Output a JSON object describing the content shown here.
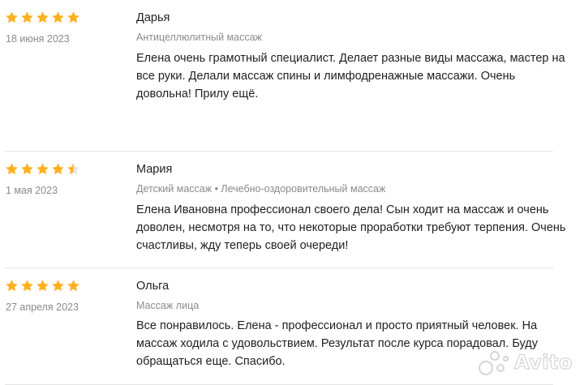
{
  "colors": {
    "star_filled": "#ffb021",
    "star_empty": "#e2e2e2",
    "muted_text": "#8a8a8a",
    "divider": "#e4e4e4"
  },
  "reviews": [
    {
      "rating": 5,
      "date": "18 июня 2023",
      "author": "Дарья",
      "service": "Антицеллюлитный массаж",
      "text": "Елена очень грамотный специалист. Делает разные виды массажа, мастер на все руки. Делали массаж спины и лимфодренажные массажи. Очень довольна! Прилу ещё."
    },
    {
      "rating": 4.5,
      "date": "1 мая 2023",
      "author": "Мария",
      "service": "Детский массаж • Лечебно-оздоровительный массаж",
      "text": "Елена Ивановна профессионал своего дела! Сын ходит на массаж и очень доволен, несмотря на то, что некоторые проработки требуют терпения. Очень счастливы, жду теперь своей очереди!"
    },
    {
      "rating": 5,
      "date": "27 апреля 2023",
      "author": "Ольга",
      "service": "Массаж лица",
      "text": "Все понравилось. Елена - профессионал и просто приятный человек. На массаж ходила с удовольствием. Результат после курса порадовал. Буду обращаться еще. Спасибо."
    }
  ],
  "watermark": {
    "text": "Avito",
    "icon": "avito-logo-icon"
  }
}
